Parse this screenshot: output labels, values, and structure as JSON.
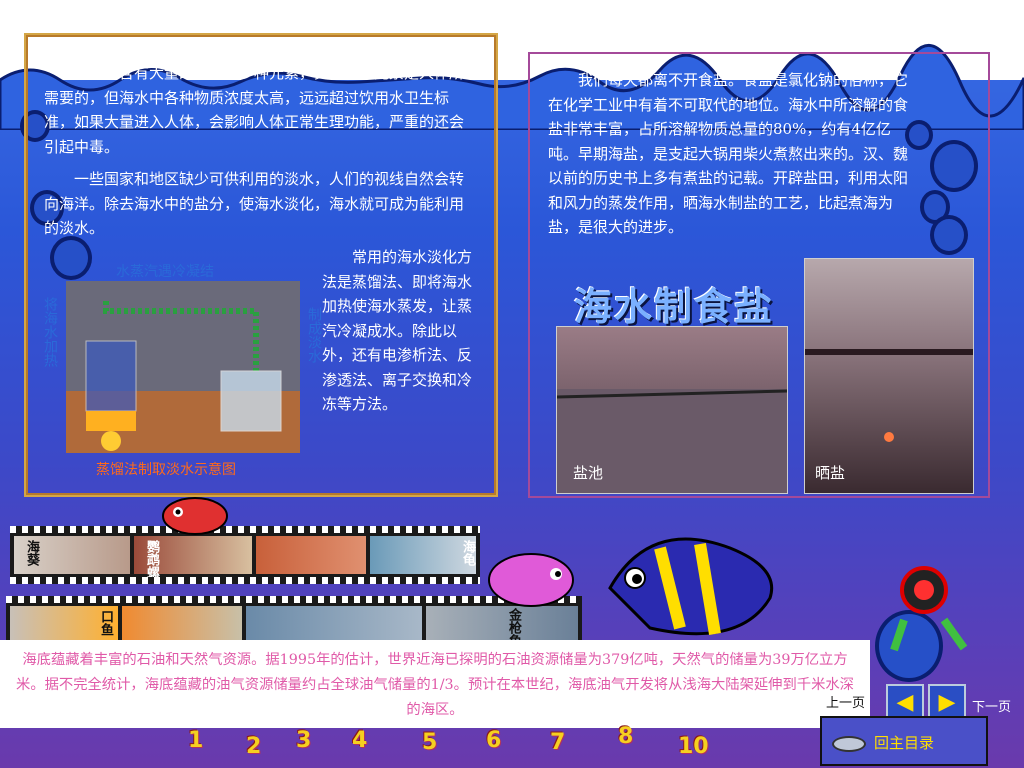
{
  "left_panel": {
    "para1": "海水中含有大量的盐类和多种元素，其中许多元素是人体所需要的，但海水中各种物质浓度太高，远远超过饮用水卫生标准，如果大量进入人体，会影响人体正常生理功能，严重的还会引起中毒。",
    "para2": "一些国家和地区缺少可供利用的淡水，人们的视线自然会转向海洋。除去海水中的盐分，使海水淡化，海水就可成为能利用的淡水。",
    "para3": "常用的海水淡化方法是蒸馏法、即将海水加热使海水蒸发，让蒸汽冷凝成水。除此以外，还有电渗析法、反渗透法、离子交换和冷冻等方法。",
    "diagram_top_label": "水蒸汽遇冷凝结",
    "diagram_left_label": "将海水加热",
    "diagram_right_label": "制成淡水",
    "diagram_caption": "蒸馏法制取淡水示意图"
  },
  "right_panel": {
    "para": "我们每天都离不开食盐。食盐是氯化钠的俗称，它在化学工业中有着不可取代的地位。海水中所溶解的食盐非常丰富，占所溶解物质总量的80%，约有4亿亿吨。早期海盐，是支起大锅用柴火煮熬出来的。汉、魏以前的历史书上多有煮盐的记载。开辟盐田，利用太阳和风力的蒸发作用，晒海水制盐的工艺，比起煮海为盐，是很大的进步。",
    "heading": "海水制食盐",
    "photo1_label": "盐池",
    "photo2_label": "晒盐"
  },
  "film": {
    "row1_labels": [
      "海葵",
      "鹦鹉螺",
      "海龟"
    ],
    "row2_labels": [
      "口鱼",
      "金枪鱼"
    ]
  },
  "info_text": "海底蕴藏着丰富的石油和天然气资源。据1995年的估计，世界近海已探明的石油资源储量为379亿吨，天然气的储量为39万亿立方米。据不完全统计，海底蕴藏的油气资源储量约占全球油气储量的1/3。预计在本世纪，海底油气开发将从浅海大陆架延伸到千米水深的海区。",
  "nav": {
    "prev_label": "上一页",
    "next_label": "下一页",
    "prev_arrow": "◀",
    "next_arrow": "▶",
    "home_label": "回主目录",
    "numbers": [
      "1",
      "2",
      "3",
      "4",
      "5",
      "6",
      "7",
      "8",
      "10"
    ]
  },
  "colors": {
    "accent_yellow": "#ffde00",
    "caption_orange": "#ff6a1a",
    "diagram_label_blue": "#2a6ad8",
    "info_pink": "#e05aa8"
  }
}
